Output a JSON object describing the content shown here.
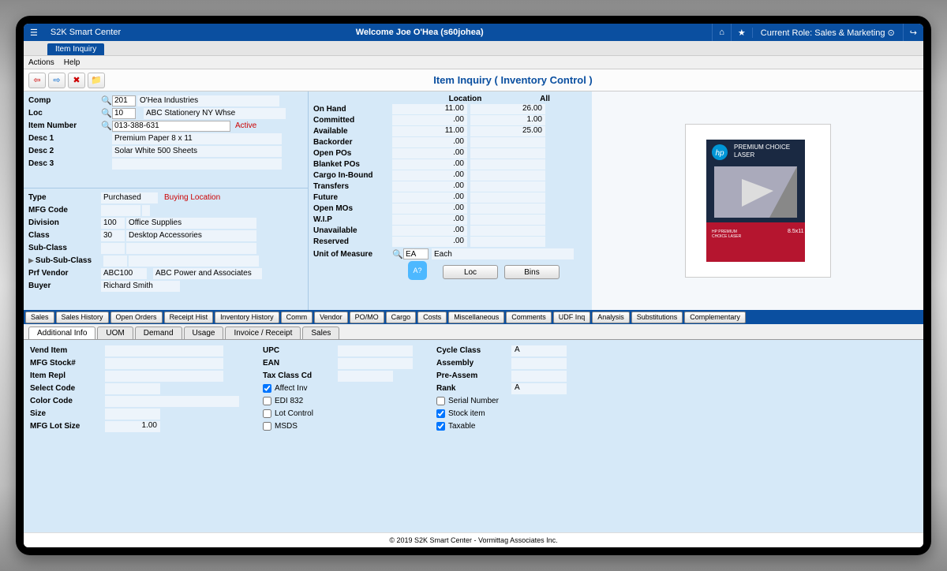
{
  "topbar": {
    "appTitle": "S2K Smart Center",
    "welcome": "Welcome Joe O'Hea (s60johea)",
    "roleLabel": "Current Role: Sales & Marketing ⊙"
  },
  "tab": {
    "name": "Item Inquiry"
  },
  "menu": {
    "actions": "Actions",
    "help": "Help"
  },
  "pageTitle": "Item Inquiry ( Inventory Control )",
  "fields": {
    "comp": {
      "label": "Comp",
      "code": "201",
      "name": "O'Hea Industries"
    },
    "loc": {
      "label": "Loc",
      "code": "10",
      "name": "ABC Stationery NY Whse"
    },
    "itemNumber": {
      "label": "Item Number",
      "value": "013-388-631",
      "status": "Active"
    },
    "desc1": {
      "label": "Desc 1",
      "value": "Premium Paper 8 x 11"
    },
    "desc2": {
      "label": "Desc 2",
      "value": "Solar White 500 Sheets"
    },
    "desc3": {
      "label": "Desc 3",
      "value": ""
    },
    "type": {
      "label": "Type",
      "value": "Purchased",
      "note": "Buying Location"
    },
    "mfgCode": {
      "label": "MFG Code",
      "value": ""
    },
    "division": {
      "label": "Division",
      "code": "100",
      "name": "Office Supplies"
    },
    "class": {
      "label": "Class",
      "code": "30",
      "name": "Desktop Accessories"
    },
    "subClass": {
      "label": "Sub-Class"
    },
    "subSubClass": {
      "label": "Sub-Sub-Class"
    },
    "prfVendor": {
      "label": "Prf Vendor",
      "code": "ABC100",
      "name": "ABC Power and Associates"
    },
    "buyer": {
      "label": "Buyer",
      "value": "Richard Smith"
    }
  },
  "inv": {
    "hLocation": "Location",
    "hAll": "All",
    "rows": [
      {
        "label": "On Hand",
        "loc": "11.00",
        "all": "26.00"
      },
      {
        "label": "Committed",
        "loc": ".00",
        "all": "1.00"
      },
      {
        "label": "Available",
        "loc": "11.00",
        "all": "25.00"
      },
      {
        "label": "Backorder",
        "loc": ".00",
        "all": ""
      },
      {
        "label": "Open POs",
        "loc": ".00",
        "all": ""
      },
      {
        "label": "Blanket POs",
        "loc": ".00",
        "all": ""
      },
      {
        "label": "Cargo In-Bound",
        "loc": ".00",
        "all": ""
      },
      {
        "label": "Transfers",
        "loc": ".00",
        "all": ""
      },
      {
        "label": "Future",
        "loc": ".00",
        "all": ""
      },
      {
        "label": "Open MOs",
        "loc": ".00",
        "all": ""
      },
      {
        "label": "W.I.P",
        "loc": ".00",
        "all": ""
      },
      {
        "label": "Unavailable",
        "loc": ".00",
        "all": ""
      },
      {
        "label": "Reserved",
        "loc": ".00",
        "all": ""
      }
    ],
    "uom": {
      "label": "Unit of Measure",
      "code": "EA",
      "name": "Each"
    },
    "locBtn": "Loc",
    "binsBtn": "Bins"
  },
  "tabs1": [
    "Sales",
    "Sales History",
    "Open Orders",
    "Receipt Hist",
    "Inventory History",
    "Comm",
    "Vendor",
    "PO/MO",
    "Cargo",
    "Costs",
    "Miscellaneous",
    "Comments",
    "UDF Inq",
    "Analysis",
    "Substitutions",
    "Complementary"
  ],
  "tabs2": [
    "Additional Info",
    "UOM",
    "Demand",
    "Usage",
    "Invoice / Receipt",
    "Sales"
  ],
  "detail": {
    "vendItem": "Vend Item",
    "mfgStock": "MFG Stock#",
    "itemRepl": "Item Repl",
    "selectCode": "Select Code",
    "colorCode": "Color Code",
    "size": "Size",
    "mfgLotSize": "MFG Lot Size",
    "mfgLotSizeVal": "1.00",
    "upc": "UPC",
    "ean": "EAN",
    "taxClass": "Tax Class Cd",
    "affectInv": "Affect Inv",
    "edi832": "EDI 832",
    "lotControl": "Lot Control",
    "msds": "MSDS",
    "cycleClass": "Cycle Class",
    "cycleClassVal": "A",
    "assembly": "Assembly",
    "preAssem": "Pre-Assem",
    "rank": "Rank",
    "rankVal": "A",
    "serialNumber": "Serial Number",
    "stockItem": "Stock item",
    "taxable": "Taxable"
  },
  "footer": "© 2019 S2K Smart Center - Vormittag Associates Inc."
}
